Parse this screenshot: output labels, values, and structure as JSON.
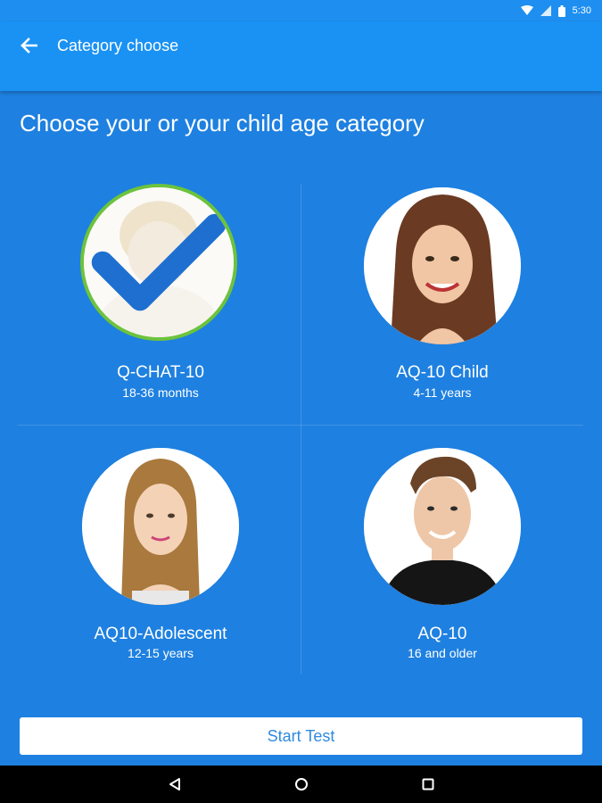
{
  "status_bar": {
    "time": "5:30"
  },
  "app_bar": {
    "title": "Category choose",
    "back_icon": "arrow-left-icon"
  },
  "heading": "Choose your or your child age category",
  "categories": [
    {
      "title": "Q-CHAT-10",
      "subtitle": "18-36 months",
      "selected": true
    },
    {
      "title": "AQ-10 Child",
      "subtitle": "4-11 years",
      "selected": false
    },
    {
      "title": "AQ10-Adolescent",
      "subtitle": "12-15 years",
      "selected": false
    },
    {
      "title": "AQ-10",
      "subtitle": "16 and older",
      "selected": false
    }
  ],
  "start_button": "Start Test",
  "colors": {
    "background": "#1e80e0",
    "app_bar": "#1a92f4",
    "selected_ring": "#6cc33c",
    "check": "#1e6fd0",
    "button_text": "#2f8ae0"
  }
}
